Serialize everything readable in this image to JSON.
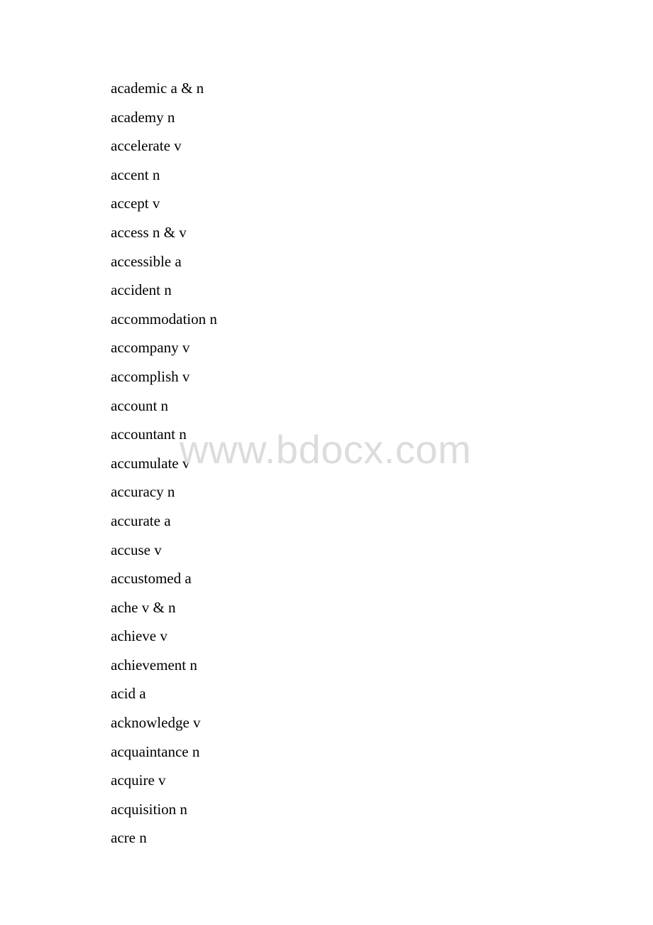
{
  "document": {
    "entries": [
      {
        "word": "academic",
        "pos": "a & n"
      },
      {
        "word": "academy",
        "pos": "n"
      },
      {
        "word": "accelerate",
        "pos": "v"
      },
      {
        "word": "accent",
        "pos": "n"
      },
      {
        "word": "accept",
        "pos": "v"
      },
      {
        "word": "access",
        "pos": "n & v"
      },
      {
        "word": "accessible",
        "pos": "a"
      },
      {
        "word": "accident",
        "pos": "n"
      },
      {
        "word": "accommodation",
        "pos": "n"
      },
      {
        "word": "accompany",
        "pos": "v"
      },
      {
        "word": "accomplish",
        "pos": "v"
      },
      {
        "word": "account",
        "pos": "n"
      },
      {
        "word": "accountant",
        "pos": "n"
      },
      {
        "word": "accumulate",
        "pos": "v"
      },
      {
        "word": "accuracy",
        "pos": "n"
      },
      {
        "word": "accurate",
        "pos": "a"
      },
      {
        "word": "accuse",
        "pos": "v"
      },
      {
        "word": "accustomed",
        "pos": "a"
      },
      {
        "word": "ache",
        "pos": "v & n"
      },
      {
        "word": "achieve",
        "pos": "v"
      },
      {
        "word": "achievement",
        "pos": "n"
      },
      {
        "word": "acid",
        "pos": "a"
      },
      {
        "word": "acknowledge",
        "pos": "v"
      },
      {
        "word": "acquaintance",
        "pos": "n"
      },
      {
        "word": "acquire",
        "pos": "v"
      },
      {
        "word": "acquisition",
        "pos": "n"
      },
      {
        "word": "acre",
        "pos": "n"
      }
    ]
  },
  "watermark": {
    "text": "www.bdocx.com",
    "color": "#dcdcdc"
  }
}
